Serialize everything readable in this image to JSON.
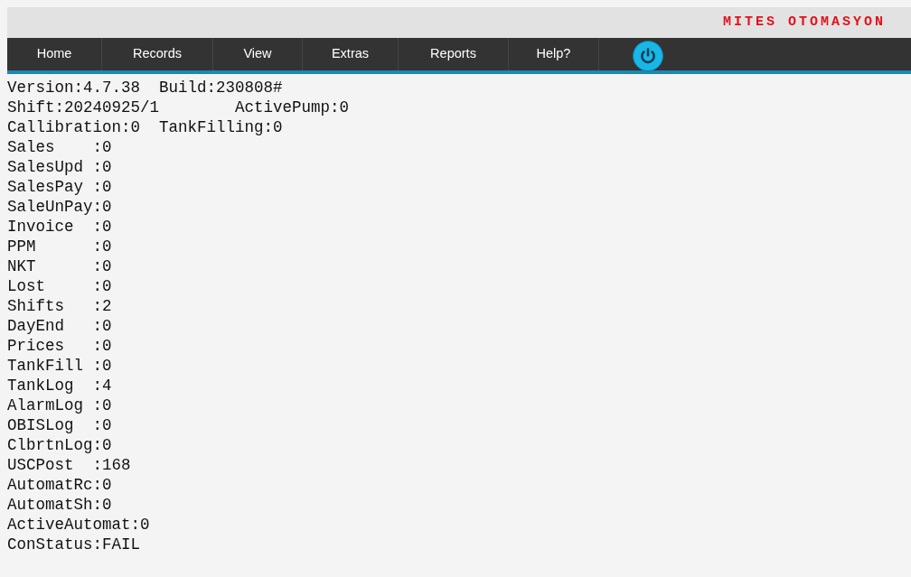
{
  "header": {
    "brand": "MITES OTOMASYON"
  },
  "nav": [
    {
      "label": "Home"
    },
    {
      "label": "Records"
    },
    {
      "label": "View"
    },
    {
      "label": "Extras"
    },
    {
      "label": "Reports"
    },
    {
      "label": "Help?"
    }
  ],
  "status_lines": [
    "Version:4.7.38  Build:230808#",
    "Shift:20240925/1        ActivePump:0",
    "Callibration:0  TankFilling:0",
    "Sales    :0",
    "SalesUpd :0",
    "SalesPay :0",
    "SaleUnPay:0",
    "Invoice  :0",
    "PPM      :0",
    "NKT      :0",
    "Lost     :0",
    "Shifts   :2",
    "DayEnd   :0",
    "Prices   :0",
    "TankFill :0",
    "TankLog  :4",
    "AlarmLog :0",
    "OBISLog  :0",
    "ClbrtnLog:0",
    "USCPost  :168",
    "AutomatRc:0",
    "AutomatSh:0",
    "ActiveAutomat:0",
    "ConStatus:FAIL"
  ]
}
